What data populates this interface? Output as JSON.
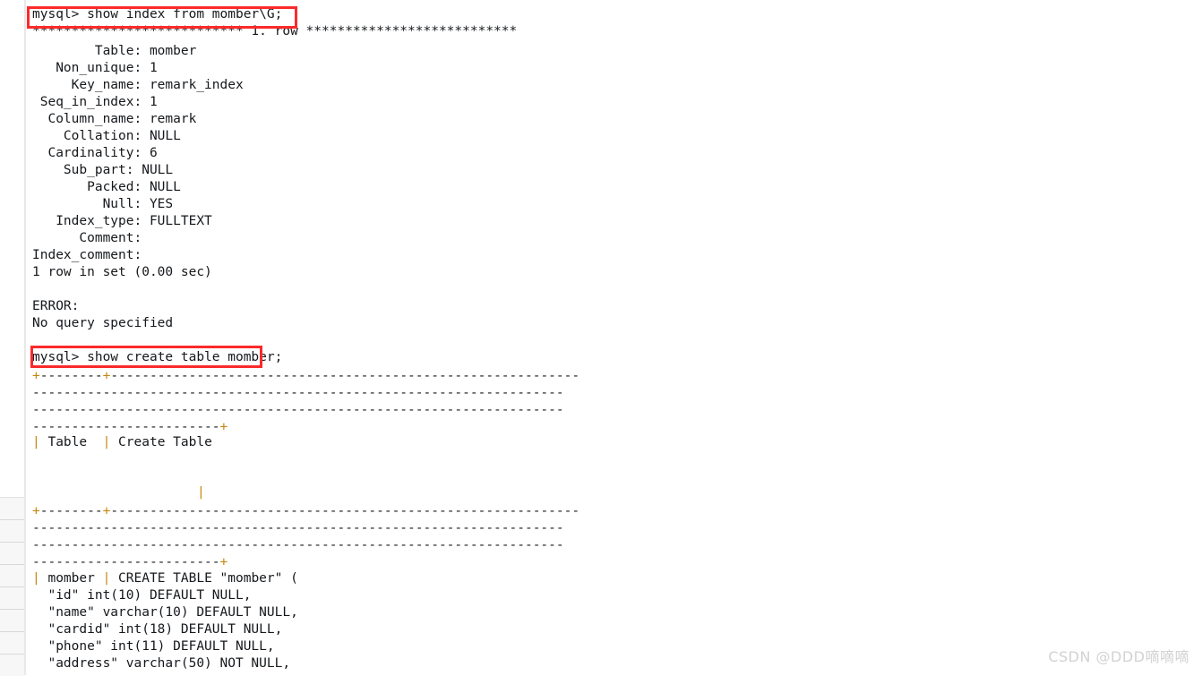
{
  "watermark": "CSDN @DDD嘀嘀嘀",
  "terminal": {
    "prompt_1": "mysql> show index from momber\\G;",
    "row_banner": "*************************** 1. row ***************************",
    "index_fields": [
      "        Table: momber",
      "   Non_unique: 1",
      "     Key_name: remark_index",
      " Seq_in_index: 1",
      "  Column_name: remark",
      "    Collation: NULL",
      "  Cardinality: 6",
      "    Sub_part: NULL",
      "       Packed: NULL",
      "         Null: YES",
      "   Index_type: FULLTEXT",
      "      Comment:",
      "Index_comment:"
    ],
    "rows_in_set": "1 row in set (0.00 sec)",
    "error_label": "ERROR:",
    "error_text": "No query specified",
    "prompt_2": "mysql> show create table momber;",
    "sep_top": [
      "+--------+------------------------------------------------------------",
      "--------------------------------------------------------------------",
      "--------------------------------------------------------------------",
      "------------------------+"
    ],
    "header_row": "| Table  | Create Table",
    "header_tail_pipe": "|",
    "sep_bottom": [
      "+--------+------------------------------------------------------------",
      "--------------------------------------------------------------------",
      "--------------------------------------------------------------------",
      "------------------------+"
    ],
    "create_table_lines": [
      "| momber | CREATE TABLE \"momber\" (",
      "  \"id\" int(10) DEFAULT NULL,",
      "  \"name\" varchar(10) DEFAULT NULL,",
      "  \"cardid\" int(18) DEFAULT NULL,",
      "  \"phone\" int(11) DEFAULT NULL,",
      "  \"address\" varchar(50) NOT NULL,"
    ]
  },
  "annotations": {
    "box_1_label": "highlight-show-index-command",
    "box_2_label": "highlight-show-create-table-command"
  },
  "colors": {
    "text": "#15181c",
    "accent_pipe": "#c8860d",
    "annotation": "#fb2a2a",
    "watermark": "#d2d2d2",
    "gutter_rule": "#e8e8e8"
  }
}
